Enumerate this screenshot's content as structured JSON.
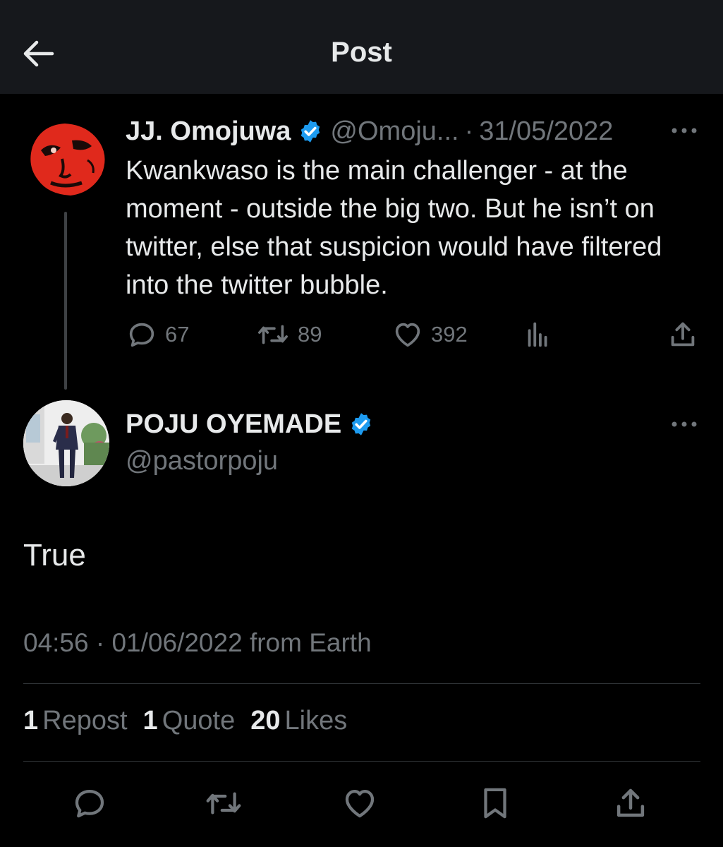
{
  "header": {
    "title": "Post"
  },
  "original": {
    "name": "JJ. Omojuwa",
    "handle": "@Omoju...",
    "sep": "·",
    "date": "31/05/2022",
    "text": "Kwankwaso is the main challenger - at the moment - outside the big two. But he isn’t on twitter, else that suspicion would have filtered into the twitter bubble.",
    "replies": "67",
    "reposts": "89",
    "likes": "392"
  },
  "reply": {
    "name": "POJU OYEMADE",
    "handle": "@pastorpoju",
    "text": "True",
    "time": "04:56",
    "sep": "·",
    "date": "01/06/2022",
    "source": "from Earth"
  },
  "stats": {
    "reposts_count": "1",
    "reposts_label": "Repost",
    "quotes_count": "1",
    "quotes_label": "Quote",
    "likes_count": "20",
    "likes_label": "Likes"
  },
  "icons": {
    "back": "arrow-left-icon",
    "verified": "verified-badge-icon",
    "more": "more-horizontal-icon",
    "reply": "reply-icon",
    "repost": "repost-icon",
    "like": "heart-icon",
    "views": "analytics-icon",
    "share": "share-icon",
    "bookmark": "bookmark-icon"
  },
  "colors": {
    "background": "#000000",
    "header": "#16181c",
    "text": "#e7e9ea",
    "muted": "#71767b",
    "verified": "#1d9bf0",
    "divider": "#2f3336"
  }
}
